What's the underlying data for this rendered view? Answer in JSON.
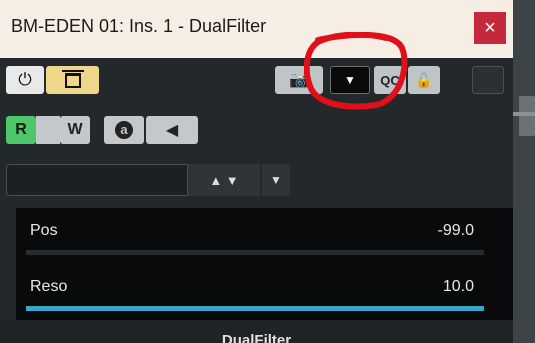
{
  "window": {
    "title": "BM-EDEN 01: Ins. 1 - DualFilter",
    "close_glyph": "×"
  },
  "toolbar": {
    "power_icon": "power-icon",
    "power_glyph": "⏻",
    "bypass_icon": "bypass-icon",
    "camera_icon": "camera-icon",
    "camera_glyph": "📷",
    "preset_dropdown_glyph": "▼",
    "qc_label": "QC",
    "lock_icon": "lock-icon",
    "lock_glyph": "🔓"
  },
  "automation": {
    "read_label": "R",
    "write_label": "W",
    "a_label": "a",
    "back_glyph": "◀"
  },
  "navigation": {
    "name_value": "",
    "updown_glyph": "▲ ▼",
    "dropdown_glyph": "▼"
  },
  "parameters": [
    {
      "name": "Pos",
      "value": "-99.0",
      "fill_fraction": 0.0
    },
    {
      "name": "Reso",
      "value": "10.0",
      "fill_fraction": 1.0
    }
  ],
  "footer": {
    "plugin_name": "DualFilter"
  },
  "colors": {
    "titlebar": "#f6eee5",
    "close": "#c4283a",
    "read_active": "#4ec66c",
    "bypass": "#eed68a",
    "param_fill": "#3aa6c9",
    "annotation": "#e0101a"
  }
}
